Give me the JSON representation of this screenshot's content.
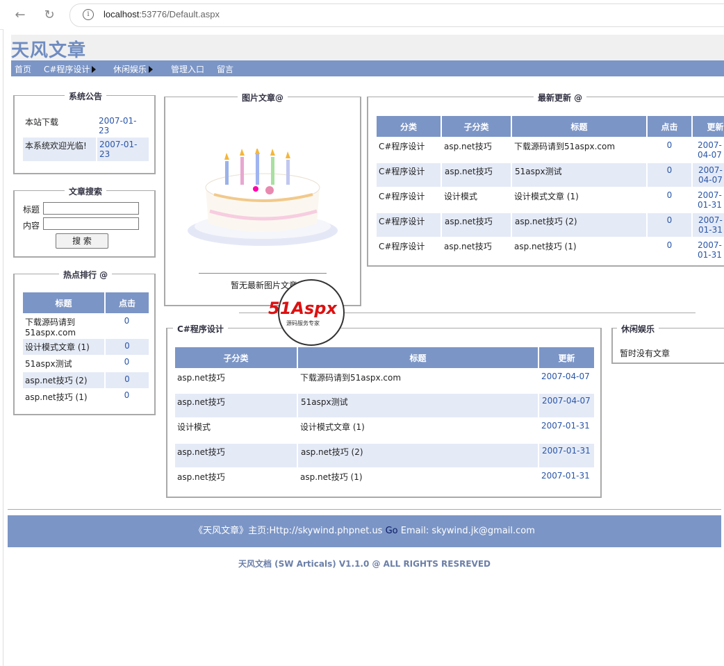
{
  "browser": {
    "url_host": "localhost",
    "url_rest": ":53776/Default.aspx"
  },
  "site": {
    "title": "天风文章",
    "menu": [
      "首页",
      "C#程序设计",
      "休闲娱乐",
      "管理入口",
      "留言"
    ]
  },
  "announce": {
    "title": "系统公告",
    "items": [
      {
        "text": "本站下载",
        "date": "2007-01-23"
      },
      {
        "text": "本系统欢迎光临!",
        "date": "2007-01-23"
      }
    ]
  },
  "search": {
    "title": "文章搜索",
    "label_title": "标题",
    "label_content": "内容",
    "button": "搜 索"
  },
  "hot": {
    "title": "热点排行 @",
    "headers": [
      "标题",
      "点击"
    ],
    "rows": [
      {
        "title": "下载源码请到51aspx.com",
        "clicks": "0"
      },
      {
        "title": "设计模式文章 (1)",
        "clicks": "0"
      },
      {
        "title": "51aspx测试",
        "clicks": "0"
      },
      {
        "title": "asp.net技巧 (2)",
        "clicks": "0"
      },
      {
        "title": "asp.net技巧 (1)",
        "clicks": "0"
      }
    ]
  },
  "image_articles": {
    "title": "图片文章@",
    "empty": "暂无最新图片文章",
    "image_icon": "birthday-cake"
  },
  "latest": {
    "title": "最新更新 @",
    "headers": [
      "分类",
      "子分类",
      "标题",
      "点击",
      "更新"
    ],
    "rows": [
      {
        "cat": "C#程序设计",
        "sub": "asp.net技巧",
        "title": "下载源码请到51aspx.com",
        "clicks": "0",
        "date": "2007-04-07"
      },
      {
        "cat": "C#程序设计",
        "sub": "asp.net技巧",
        "title": "51aspx测试",
        "clicks": "0",
        "date": "2007-04-07"
      },
      {
        "cat": "C#程序设计",
        "sub": "设计模式",
        "title": "设计模式文章 (1)",
        "clicks": "0",
        "date": "2007-01-31"
      },
      {
        "cat": "C#程序设计",
        "sub": "asp.net技巧",
        "title": "asp.net技巧 (2)",
        "clicks": "0",
        "date": "2007-01-31"
      },
      {
        "cat": "C#程序设计",
        "sub": "asp.net技巧",
        "title": "asp.net技巧 (1)",
        "clicks": "0",
        "date": "2007-01-31"
      }
    ]
  },
  "csharp": {
    "title": "C#程序设计",
    "headers": [
      "子分类",
      "标题",
      "更新"
    ],
    "rows": [
      {
        "sub": "asp.net技巧",
        "title": "下载源码请到51aspx.com",
        "date": "2007-04-07"
      },
      {
        "sub": "asp.net技巧",
        "title": "51aspx测试",
        "date": "2007-04-07"
      },
      {
        "sub": "设计模式",
        "title": "设计模式文章 (1)",
        "date": "2007-01-31"
      },
      {
        "sub": "asp.net技巧",
        "title": "asp.net技巧 (2)",
        "date": "2007-01-31"
      },
      {
        "sub": "asp.net技巧",
        "title": "asp.net技巧 (1)",
        "date": "2007-01-31"
      }
    ]
  },
  "leisure": {
    "title": "休闲娱乐",
    "empty": "暂时没有文章"
  },
  "footer": {
    "line_left": "《天风文章》主页:Http://skywind.phpnet.us",
    "go": "Go",
    "line_right": "Email: skywind.jk@gmail.com",
    "copyright": "天风文档 (SW Articals) V1.1.0 @ ALL RIGHTS RESREVED"
  },
  "watermark": {
    "logo": "51Aspx",
    "sub": "源码服务专家"
  }
}
